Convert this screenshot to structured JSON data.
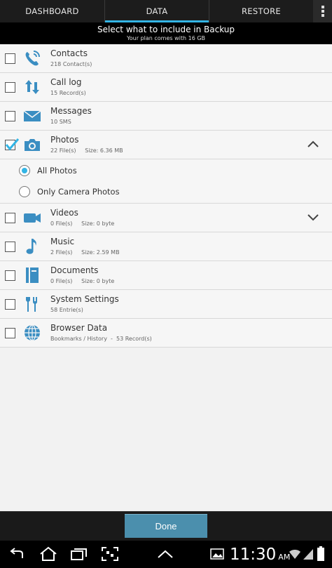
{
  "tabs": [
    {
      "label": "DASHBOARD"
    },
    {
      "label": "DATA"
    },
    {
      "label": "RESTORE"
    }
  ],
  "banner": {
    "title": "Select what to include in Backup",
    "subtitle": "Your plan comes with 16 GB"
  },
  "items": [
    {
      "title": "Contacts",
      "sub": "218 Contact(s)",
      "checked": false,
      "icon": "phone-icon"
    },
    {
      "title": "Call log",
      "sub": "15 Record(s)",
      "checked": false,
      "icon": "call-log-icon"
    },
    {
      "title": "Messages",
      "sub": "10 SMS",
      "checked": false,
      "icon": "envelope-icon"
    },
    {
      "title": "Photos",
      "sub": "22 File(s)     Size: 6.36 MB",
      "checked": true,
      "icon": "camera-icon"
    },
    {
      "title": "Videos",
      "sub": "0 File(s)     Size: 0 byte",
      "checked": false,
      "icon": "video-camera-icon"
    },
    {
      "title": "Music",
      "sub": "2 File(s)     Size: 2.59 MB",
      "checked": false,
      "icon": "music-note-icon"
    },
    {
      "title": "Documents",
      "sub": "0 File(s)     Size: 0 byte",
      "checked": false,
      "icon": "document-icon"
    },
    {
      "title": "System Settings",
      "sub": "58 Entrie(s)",
      "checked": false,
      "icon": "tools-icon"
    },
    {
      "title": "Browser Data",
      "sub": "Bookmarks / History  -  53 Record(s)",
      "checked": false,
      "icon": "globe-icon"
    }
  ],
  "photo_options": [
    {
      "label": "All Photos",
      "selected": true
    },
    {
      "label": "Only Camera Photos",
      "selected": false
    }
  ],
  "footer": {
    "done_label": "Done"
  },
  "status": {
    "time": "11:30",
    "ampm": "AM"
  },
  "colors": {
    "accent": "#33b5e5",
    "icon_blue": "#3b8ec2",
    "button": "#4b8fad"
  }
}
